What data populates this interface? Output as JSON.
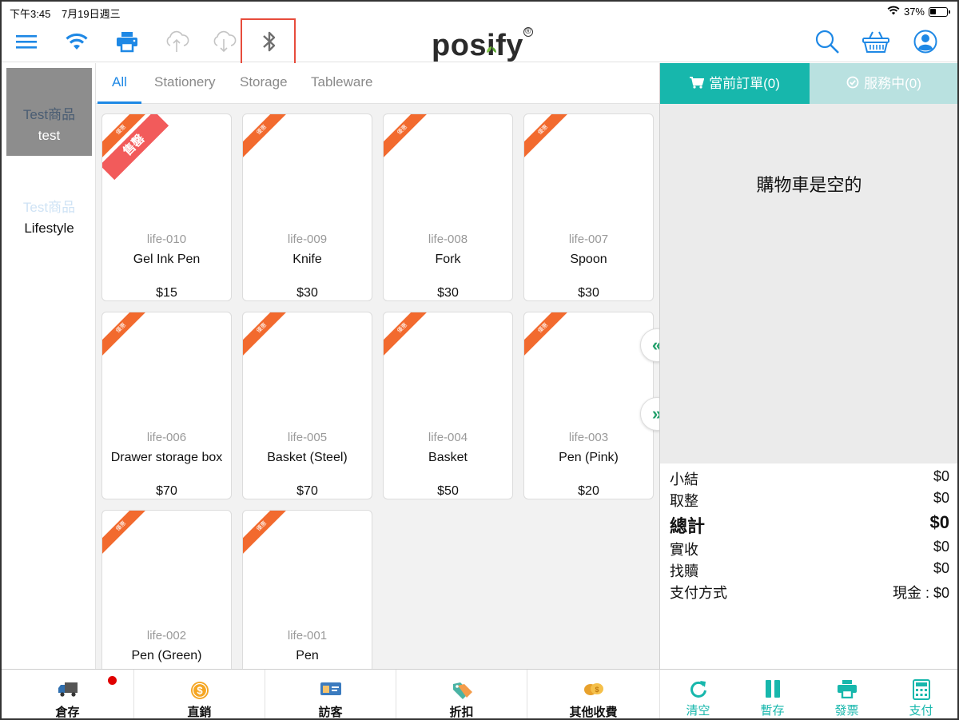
{
  "status_bar": {
    "time": "下午3:45",
    "date": "7月19日週三",
    "battery": "37%",
    "battery_level": 0.37
  },
  "toolbar": {
    "logo": "posify",
    "icons": [
      "menu-icon",
      "wifi-icon",
      "printer-icon",
      "cloud-upload-icon",
      "cloud-download-icon",
      "bluetooth-icon",
      "search-icon",
      "basket-icon",
      "user-icon"
    ]
  },
  "sidebar": {
    "categories": [
      {
        "line1": "Test商品",
        "line2": "test",
        "active": true
      },
      {
        "line1": "Test商品",
        "line2": "Lifestyle",
        "active": false
      }
    ]
  },
  "tabs": [
    {
      "label": "All",
      "active": true
    },
    {
      "label": "Stationery",
      "active": false
    },
    {
      "label": "Storage",
      "active": false
    },
    {
      "label": "Tableware",
      "active": false
    }
  ],
  "products": [
    {
      "sku": "life-010",
      "name": "Gel Ink Pen",
      "price": "$15",
      "ribbon": "優惠",
      "sold_out": "售罄"
    },
    {
      "sku": "life-009",
      "name": "Knife",
      "price": "$30",
      "ribbon": "優惠"
    },
    {
      "sku": "life-008",
      "name": "Fork",
      "price": "$30",
      "ribbon": "優惠"
    },
    {
      "sku": "life-007",
      "name": "Spoon",
      "price": "$30",
      "ribbon": "優惠"
    },
    {
      "sku": "life-006",
      "name": "Drawer storage box",
      "price": "$70",
      "ribbon": "優惠"
    },
    {
      "sku": "life-005",
      "name": "Basket (Steel)",
      "price": "$70",
      "ribbon": "優惠"
    },
    {
      "sku": "life-004",
      "name": "Basket",
      "price": "$50",
      "ribbon": "優惠"
    },
    {
      "sku": "life-003",
      "name": "Pen (Pink)",
      "price": "$20",
      "ribbon": "優惠"
    },
    {
      "sku": "life-002",
      "name": "Pen (Green)",
      "price": "",
      "ribbon": "優惠"
    },
    {
      "sku": "life-001",
      "name": "Pen",
      "price": "",
      "ribbon": "優惠"
    }
  ],
  "scroll": {
    "prev": "«",
    "next": "»"
  },
  "order_panel": {
    "tab_current": "當前訂單(0)",
    "tab_service": "服務中(0)",
    "cart_empty": "購物車是空的",
    "summary": {
      "subtotal_label": "小結",
      "subtotal": "$0",
      "rounding_label": "取整",
      "rounding": "$0",
      "total_label": "總計",
      "total": "$0",
      "received_label": "實收",
      "received": "$0",
      "change_label": "找贖",
      "change": "$0",
      "payment_label": "支付方式",
      "payment": "現金 : $0"
    }
  },
  "bottom_bar": {
    "inventory": "倉存",
    "direct_sale": "直銷",
    "visitor": "訪客",
    "discount": "折扣",
    "other_charges": "其他收費",
    "clear": "清空",
    "hold": "暫存",
    "invoice": "發票",
    "pay": "支付"
  },
  "colors": {
    "accent_blue": "#1e88e5",
    "teal": "#17b7ac",
    "teal_light": "#b9e1e0",
    "ribbon": "#f26a2e",
    "sold_out": "#f25b5b",
    "highlight": "#e74c3c"
  }
}
